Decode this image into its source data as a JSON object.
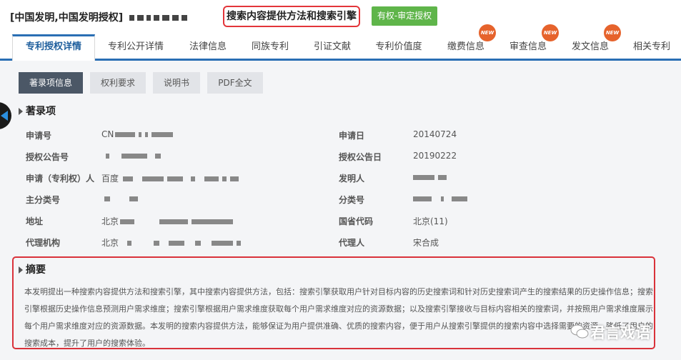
{
  "header": {
    "title_prefix": "[中国发明,中国发明授权]",
    "title_highlight": "搜索内容提供方法和搜索引擎",
    "status_badge": "有权-审定授权"
  },
  "tabs": [
    {
      "label": "专利授权详情",
      "active": true,
      "new": false
    },
    {
      "label": "专利公开详情",
      "active": false,
      "new": false
    },
    {
      "label": "法律信息",
      "active": false,
      "new": false
    },
    {
      "label": "同族专利",
      "active": false,
      "new": false
    },
    {
      "label": "引证文献",
      "active": false,
      "new": false
    },
    {
      "label": "专利价值度",
      "active": false,
      "new": false
    },
    {
      "label": "缴费信息",
      "active": false,
      "new": true
    },
    {
      "label": "审查信息",
      "active": false,
      "new": true
    },
    {
      "label": "发文信息",
      "active": false,
      "new": true
    },
    {
      "label": "相关专利",
      "active": false,
      "new": false
    }
  ],
  "new_badge_text": "NEW",
  "sub_tabs": [
    {
      "label": "著录项信息",
      "active": true
    },
    {
      "label": "权利要求",
      "active": false
    },
    {
      "label": "说明书",
      "active": false
    },
    {
      "label": "PDF全文",
      "active": false
    }
  ],
  "bibliographic": {
    "section_title": "著录项",
    "fields": {
      "application_no": {
        "label": "申请号",
        "value": "CN"
      },
      "application_date": {
        "label": "申请日",
        "value": "20140724"
      },
      "grant_pub_no": {
        "label": "授权公告号",
        "value": ""
      },
      "grant_pub_date": {
        "label": "授权公告日",
        "value": "20190222"
      },
      "applicant": {
        "label": "申请（专利权）人",
        "value": "百度"
      },
      "inventor": {
        "label": "发明人",
        "value": ""
      },
      "main_class": {
        "label": "主分类号",
        "value": ""
      },
      "class": {
        "label": "分类号",
        "value": ""
      },
      "address": {
        "label": "地址",
        "value": "北京"
      },
      "province_code": {
        "label": "国省代码",
        "value": "北京(11)"
      },
      "agency": {
        "label": "代理机构",
        "value": "北京"
      },
      "agent": {
        "label": "代理人",
        "value": "宋合成"
      }
    }
  },
  "abstract": {
    "section_title": "摘要",
    "text": "本发明提出一种搜索内容提供方法和搜索引擎，其中搜索内容提供方法，包括：搜索引擎获取用户针对目标内容的历史搜索词和针对历史搜索词产生的搜索结果的历史操作信息；搜索引擎根据历史操作信息预测用户需求维度；搜索引擎根据用户需求维度获取每个用户需求维度对应的资源数据；以及搜索引擎接收与目标内容相关的搜索词，并按照用户需求维度展示每个用户需求维度对应的资源数据。本发明的搜索内容提供方法，能够保证为用户提供准确、优质的搜索内容，便于用户从搜索引擎提供的搜索内容中选择需要的资源，降低了用户的搜索成本，提升了用户的搜索体验。"
  },
  "watermark": "君言戏语",
  "colors": {
    "accent_blue": "#2a6fb4",
    "highlight_red": "#e3353a",
    "badge_green": "#5fb54a",
    "new_orange": "#e6632c"
  }
}
